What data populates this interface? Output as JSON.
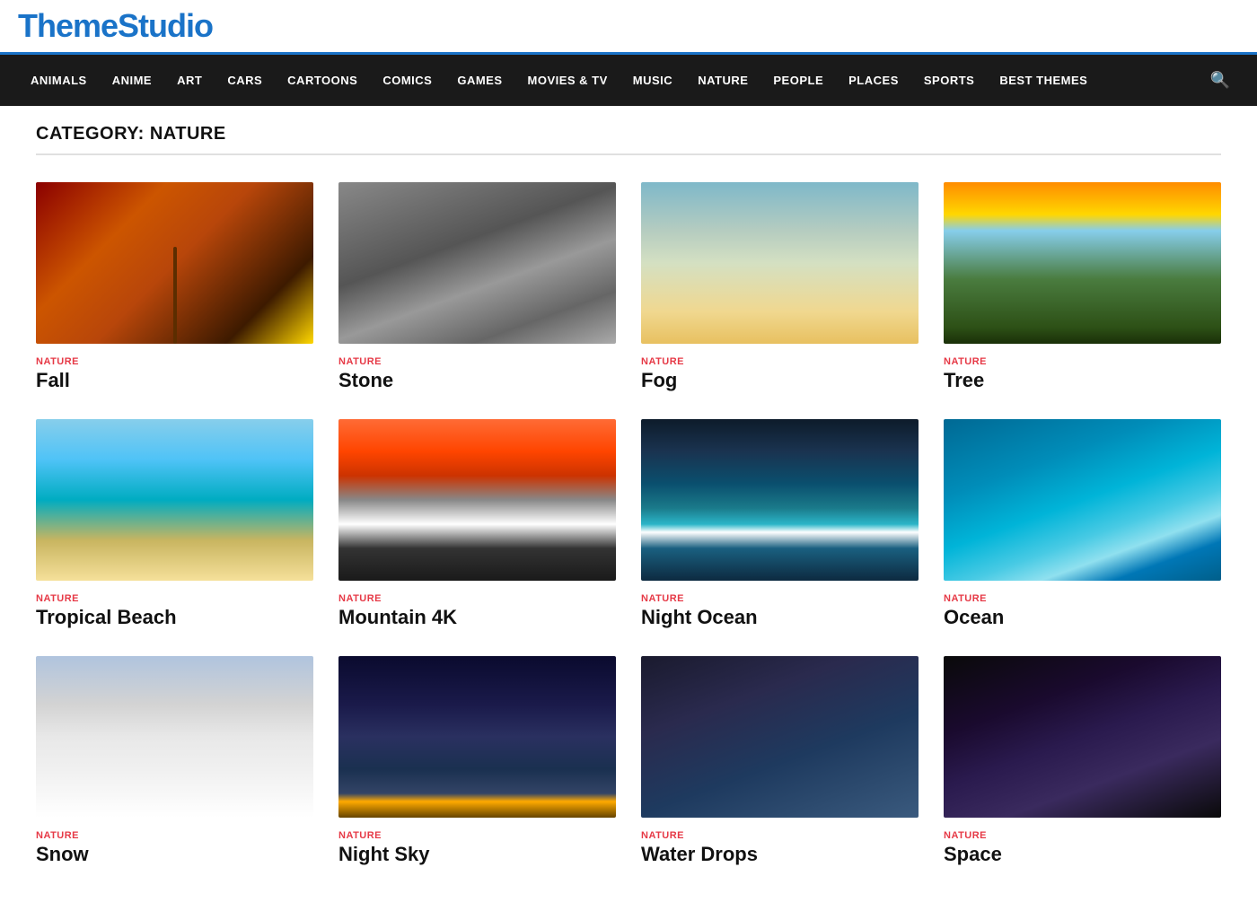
{
  "logo": {
    "text": "ThemeStudio"
  },
  "nav": {
    "items": [
      {
        "label": "ANIMALS",
        "id": "animals"
      },
      {
        "label": "ANIME",
        "id": "anime"
      },
      {
        "label": "ART",
        "id": "art"
      },
      {
        "label": "CARS",
        "id": "cars"
      },
      {
        "label": "CARTOONS",
        "id": "cartoons"
      },
      {
        "label": "COMICS",
        "id": "comics"
      },
      {
        "label": "GAMES",
        "id": "games"
      },
      {
        "label": "MOVIES & TV",
        "id": "movies-tv"
      },
      {
        "label": "MUSIC",
        "id": "music"
      },
      {
        "label": "NATURE",
        "id": "nature"
      },
      {
        "label": "PEOPLE",
        "id": "people"
      },
      {
        "label": "PLACES",
        "id": "places"
      },
      {
        "label": "SPORTS",
        "id": "sports"
      },
      {
        "label": "BEST THEMES",
        "id": "best-themes"
      }
    ]
  },
  "page": {
    "category_label": "CATEGORY: NATURE"
  },
  "cards": [
    {
      "id": "fall",
      "category": "NATURE",
      "title": "Fall",
      "img_class": "img-fall"
    },
    {
      "id": "stone",
      "category": "NATURE",
      "title": "Stone",
      "img_class": "img-stone"
    },
    {
      "id": "fog",
      "category": "NATURE",
      "title": "Fog",
      "img_class": "img-fog"
    },
    {
      "id": "tree",
      "category": "NATURE",
      "title": "Tree",
      "img_class": "img-tree"
    },
    {
      "id": "tropical-beach",
      "category": "NATURE",
      "title": "Tropical Beach",
      "img_class": "img-tropical"
    },
    {
      "id": "mountain-4k",
      "category": "NATURE",
      "title": "Mountain 4K",
      "img_class": "img-mountain"
    },
    {
      "id": "night-ocean",
      "category": "NATURE",
      "title": "Night Ocean",
      "img_class": "img-nightocean"
    },
    {
      "id": "ocean",
      "category": "NATURE",
      "title": "Ocean",
      "img_class": "img-ocean"
    },
    {
      "id": "snow",
      "category": "NATURE",
      "title": "Snow",
      "img_class": "img-snow"
    },
    {
      "id": "night-sky",
      "category": "NATURE",
      "title": "Night Sky",
      "img_class": "img-nightsky"
    },
    {
      "id": "water-drops",
      "category": "NATURE",
      "title": "Water Drops",
      "img_class": "img-drops"
    },
    {
      "id": "space",
      "category": "NATURE",
      "title": "Space",
      "img_class": "img-space"
    }
  ]
}
